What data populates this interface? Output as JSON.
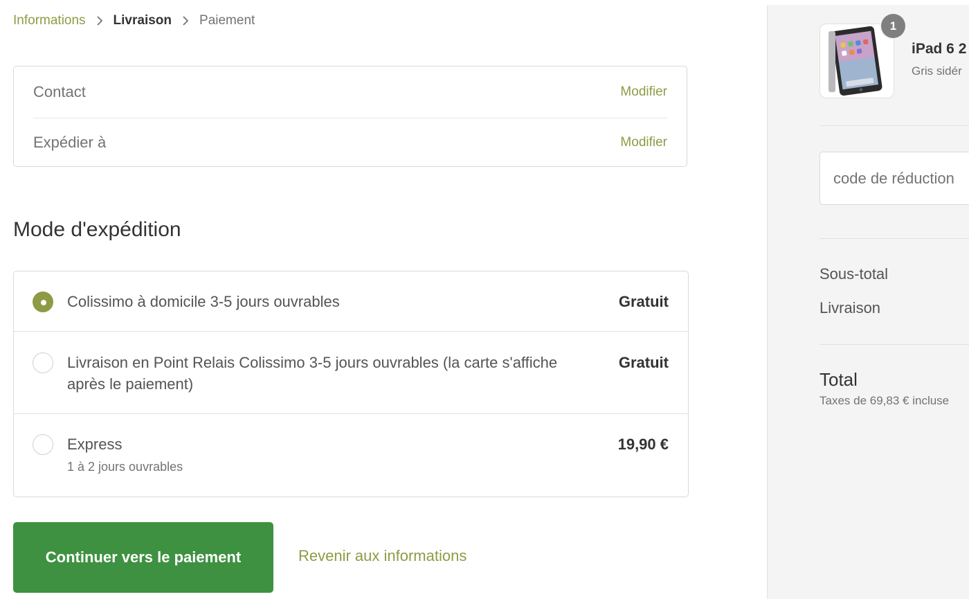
{
  "breadcrumb": {
    "steps": [
      {
        "label": "Informations",
        "state": "link"
      },
      {
        "label": "Livraison",
        "state": "current"
      },
      {
        "label": "Paiement",
        "state": "upcoming"
      }
    ]
  },
  "review": {
    "contact_label": "Contact",
    "ship_to_label": "Expédier à",
    "modify_label": "Modifier"
  },
  "shipping": {
    "title": "Mode d'expédition",
    "options": [
      {
        "label": "Colissimo à domicile 3-5 jours ouvrables",
        "sublabel": "",
        "price": "Gratuit",
        "selected": true
      },
      {
        "label": "Livraison en Point Relais Colissimo 3-5 jours ouvrables (la carte s'affiche après le paiement)",
        "sublabel": "",
        "price": "Gratuit",
        "selected": false
      },
      {
        "label": "Express",
        "sublabel": "1 à 2 jours ouvrables",
        "price": "19,90 €",
        "selected": false
      }
    ]
  },
  "actions": {
    "continue_label": "Continuer vers le paiement",
    "back_label": "Revenir aux informations"
  },
  "summary": {
    "quantity": "1",
    "product_name": "iPad 6 2",
    "product_variant": "Gris sidér",
    "discount_placeholder": "code de réduction",
    "subtotal_label": "Sous-total",
    "shipping_label": "Livraison",
    "total_label": "Total",
    "tax_note": "Taxes de 69,83 € incluse"
  },
  "colors": {
    "accent": "#8f9b44",
    "primary_button": "#3e9141",
    "sidebar_bg": "#f4f4f4"
  },
  "icons": {
    "breadcrumb_separator": "chevron-right-icon",
    "product_image": "ipad-image"
  }
}
